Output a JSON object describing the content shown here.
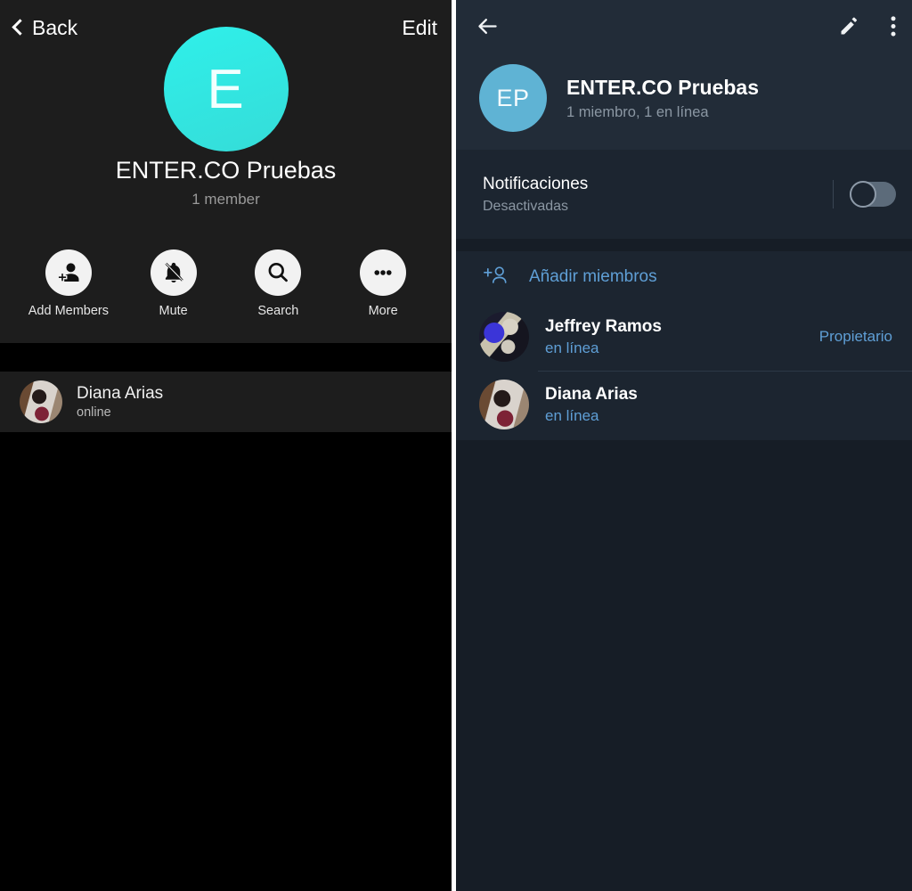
{
  "left_panel": {
    "nav": {
      "back_label": "Back",
      "back_icon": "chevron-left-icon",
      "edit_label": "Edit"
    },
    "group": {
      "avatar_initial": "E",
      "avatar_color": "#2ee6e0",
      "title": "ENTER.CO Pruebas",
      "subtitle": "1 member"
    },
    "actions": [
      {
        "label": "Add Members",
        "icon": "add-person-icon"
      },
      {
        "label": "Mute",
        "icon": "bell-slash-icon"
      },
      {
        "label": "Search",
        "icon": "search-icon"
      },
      {
        "label": "More",
        "icon": "ellipsis-icon"
      }
    ],
    "members": [
      {
        "name": "Diana Arias",
        "status": "online",
        "avatar": "photo-diana"
      }
    ]
  },
  "right_panel": {
    "topbar": {
      "back_icon": "arrow-left-icon",
      "edit_icon": "pencil-icon",
      "menu_icon": "more-vertical-icon"
    },
    "group": {
      "avatar_initials": "EP",
      "avatar_color": "#5fb3d4",
      "title": "ENTER.CO Pruebas",
      "subtitle": "1 miembro, 1 en línea"
    },
    "notifications": {
      "title": "Notificaciones",
      "state": "Desactivadas",
      "toggle_on": false
    },
    "add_members": {
      "label": "Añadir miembros",
      "icon": "add-person-outline-icon",
      "color": "#5f9fd6"
    },
    "members": [
      {
        "name": "Jeffrey Ramos",
        "status": "en línea",
        "role": "Propietario",
        "avatar": "photo-jeffrey"
      },
      {
        "name": "Diana Arias",
        "status": "en línea",
        "role": "",
        "avatar": "photo-diana"
      }
    ]
  }
}
